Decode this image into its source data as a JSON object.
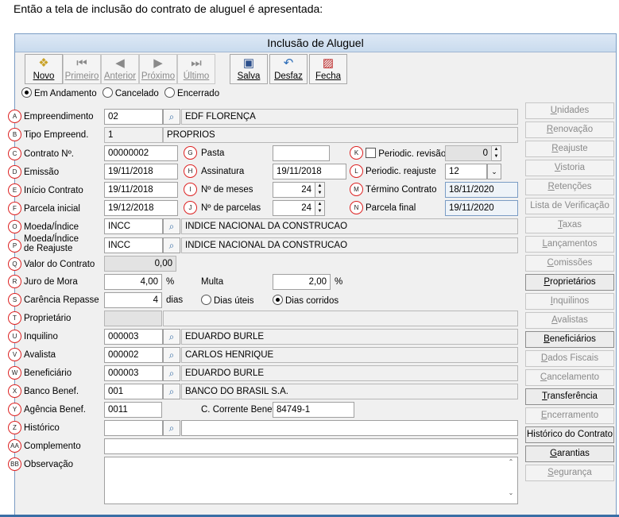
{
  "caption": "Então a tela de inclusão do contrato de aluguel é apresentada:",
  "window_title": "Inclusão de Aluguel",
  "toolbar": {
    "novo": {
      "first": "N",
      "rest": "ovo"
    },
    "primeiro": {
      "first": "P",
      "rest": "rimeiro"
    },
    "anterior": {
      "first": "A",
      "rest": "nterior"
    },
    "proximo": {
      "first": "P",
      "rest": "róximo"
    },
    "ultimo": {
      "first": "Ú",
      "rest": "ltimo"
    },
    "salva": {
      "first": "S",
      "rest": "alva"
    },
    "desfaz": {
      "first": "D",
      "rest": "esfaz"
    },
    "fecha": {
      "first": "F",
      "rest": "echa"
    }
  },
  "status_options": [
    "Em Andamento",
    "Cancelado",
    "Encerrado"
  ],
  "status_selected": "Em Andamento",
  "badges": [
    "A",
    "B",
    "C",
    "D",
    "E",
    "F",
    "O",
    "P",
    "Q",
    "R",
    "S",
    "T",
    "U",
    "V",
    "W",
    "X",
    "Y",
    "Z",
    "AA",
    "BB",
    "G",
    "H",
    "I",
    "J",
    "K",
    "L",
    "M",
    "N"
  ],
  "labels": {
    "empreendimento": "Empreendimento",
    "tipo_empreend": "Tipo Empreend.",
    "contrato_n": "Contrato Nº.",
    "emissao": "Emissão",
    "inicio_contrato": "Início Contrato",
    "parcela_inicial": "Parcela inicial",
    "moeda_indice": "Moeda/Índice",
    "moeda_indice_reajuste_1": "Moeda/Índice",
    "moeda_indice_reajuste_2": "de Reajuste",
    "valor_contrato": "Valor do Contrato",
    "juro_mora": "Juro de Mora",
    "carencia_repasse": "Carência Repasse",
    "proprietario": "Proprietário",
    "inquilino": "Inquilino",
    "avalista": "Avalista",
    "beneficiario": "Beneficiário",
    "banco_benef": "Banco Benef.",
    "agencia_benef": "Agência Benef.",
    "historico": "Histórico",
    "complemento": "Complemento",
    "observacao": "Observação",
    "pasta": "Pasta",
    "assinatura": "Assinatura",
    "n_meses": "Nº de meses",
    "n_parcelas": "Nº de parcelas",
    "multa": "Multa",
    "c_corrente_benef": "C. Corrente Benef.",
    "periodic_revisao": "Periodic. revisão",
    "periodic_reajuste": "Periodic. reajuste",
    "termino_contrato": "Término Contrato",
    "parcela_final": "Parcela final",
    "pct1": "%",
    "pct2": "%",
    "dias": "dias",
    "dias_uteis": "Dias úteis",
    "dias_corridos": "Dias corridos"
  },
  "values": {
    "empreendimento_code": "02",
    "empreendimento_name": "EDF FLORENÇA",
    "tipo_empreend_code": "1",
    "tipo_empreend_name": "PROPRIOS",
    "contrato_n": "00000002",
    "emissao": "19/11/2018",
    "inicio_contrato": "19/11/2018",
    "parcela_inicial": "19/12/2018",
    "moeda_code": "INCC",
    "moeda_name": "INDICE NACIONAL DA CONSTRUCAO",
    "moeda_reaj_code": "INCC",
    "moeda_reaj_name": "INDICE NACIONAL DA CONSTRUCAO",
    "valor_contrato": "0,00",
    "juro_mora": "4,00",
    "carencia_repasse": "4",
    "inquilino_code": "000003",
    "inquilino_name": "EDUARDO BURLE",
    "avalista_code": "000002",
    "avalista_name": "CARLOS HENRIQUE",
    "beneficiario_code": "000003",
    "beneficiario_name": "EDUARDO BURLE",
    "banco_code": "001",
    "banco_name": "BANCO DO BRASIL S.A.",
    "agencia": "0011",
    "pasta": "",
    "assinatura": "19/11/2018",
    "n_meses": "24",
    "n_parcelas": "24",
    "multa": "2,00",
    "c_corrente": "84749-1",
    "periodic_revisao": "0",
    "periodic_reajuste": "12",
    "termino_contrato": "18/11/2020",
    "parcela_final": "19/11/2020"
  },
  "carencia_mode_selected": "Dias corridos",
  "periodic_revisao_checked": false,
  "side_buttons": [
    {
      "first": "U",
      "rest": "nidades",
      "enabled": false
    },
    {
      "first": "R",
      "rest": "enovação",
      "enabled": false
    },
    {
      "first": "R",
      "rest": "eajuste",
      "enabled": false
    },
    {
      "first": "V",
      "rest": "istoria",
      "enabled": false
    },
    {
      "first": "R",
      "rest": "etenções",
      "enabled": false
    },
    {
      "first": "",
      "rest": "Lista de Verificação",
      "enabled": false
    },
    {
      "first": "T",
      "rest": "axas",
      "enabled": false
    },
    {
      "first": "L",
      "rest": "ançamentos",
      "enabled": false
    },
    {
      "first": "C",
      "rest": "omissões",
      "enabled": false
    },
    {
      "first": "P",
      "rest": "roprietários",
      "enabled": true
    },
    {
      "first": "I",
      "rest": "nquilinos",
      "enabled": false
    },
    {
      "first": "A",
      "rest": "valistas",
      "enabled": false
    },
    {
      "first": "B",
      "rest": "eneficiários",
      "enabled": true
    },
    {
      "first": "D",
      "rest": "ados Fiscais",
      "enabled": false
    },
    {
      "first": "C",
      "rest": "ancelamento",
      "enabled": false
    },
    {
      "first": "T",
      "rest": "ransferência",
      "enabled": true
    },
    {
      "first": "E",
      "rest": "ncerramento",
      "enabled": false
    },
    {
      "first": "",
      "rest": "Histórico do Contrato",
      "enabled": true
    },
    {
      "first": "G",
      "rest": "arantias",
      "enabled": true
    },
    {
      "first": "S",
      "rest": "egurança",
      "enabled": false
    }
  ]
}
